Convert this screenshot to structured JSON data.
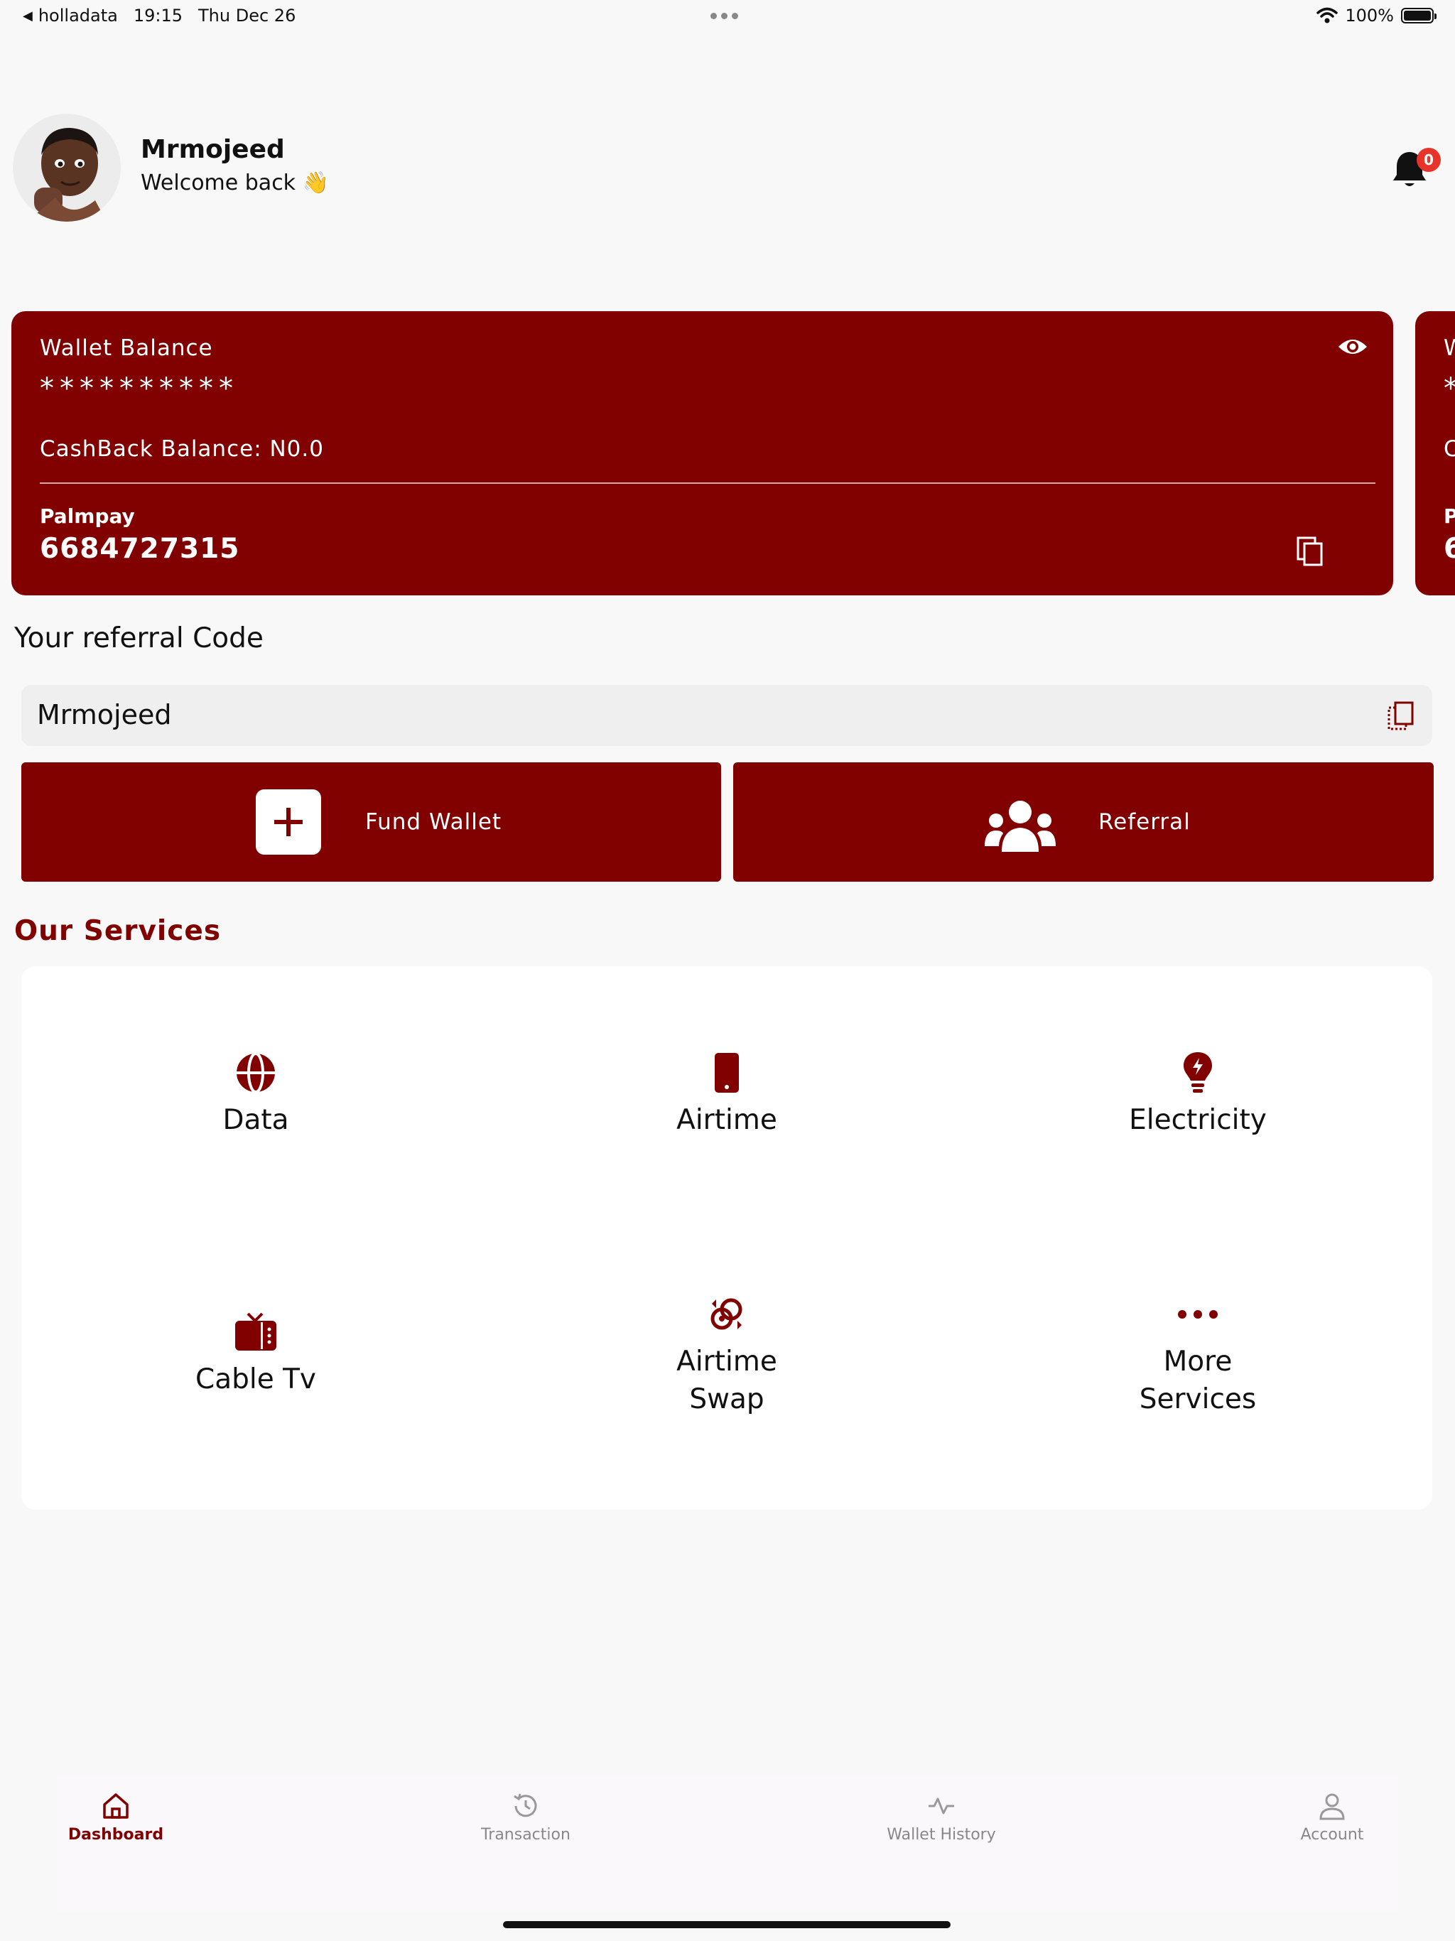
{
  "status_bar": {
    "back_app": "holladata",
    "time": "19:15",
    "date": "Thu Dec 26",
    "battery": "100%"
  },
  "header": {
    "username": "Mrmojeed",
    "welcome": "Welcome back 👋",
    "notification_count": "0"
  },
  "wallet_card": {
    "label": "Wallet Balance",
    "balance_masked": "**********",
    "cashback": "CashBack Balance: N0.0",
    "bank_name": "Palmpay",
    "account_number": "6684727315"
  },
  "wallet_card_peek": {
    "label": "W",
    "stars": "*",
    "cashback": "C",
    "bank": "P",
    "account": "6"
  },
  "referral": {
    "heading": "Your referral Code",
    "code": "Mrmojeed"
  },
  "actions": {
    "fund_wallet": "Fund Wallet",
    "referral": "Referral"
  },
  "services": {
    "heading": "Our Services",
    "items": [
      {
        "label": "Data",
        "icon": "globe-icon"
      },
      {
        "label": "Airtime",
        "icon": "phone-icon"
      },
      {
        "label": "Electricity",
        "icon": "bulb-icon"
      },
      {
        "label": "Cable Tv",
        "icon": "tv-icon"
      },
      {
        "label": "Airtime Swap",
        "icon": "swap-icon"
      },
      {
        "label": "More Services",
        "icon": "more-icon"
      }
    ]
  },
  "nav": {
    "items": [
      {
        "label": "Dashboard",
        "icon": "home-icon",
        "active": true
      },
      {
        "label": "Transaction",
        "icon": "history-icon",
        "active": false
      },
      {
        "label": "Wallet History",
        "icon": "activity-icon",
        "active": false
      },
      {
        "label": "Account",
        "icon": "user-icon",
        "active": false
      }
    ]
  },
  "colors": {
    "brand": "#810000",
    "badge": "#e8332a",
    "background": "#f8f8f8"
  }
}
